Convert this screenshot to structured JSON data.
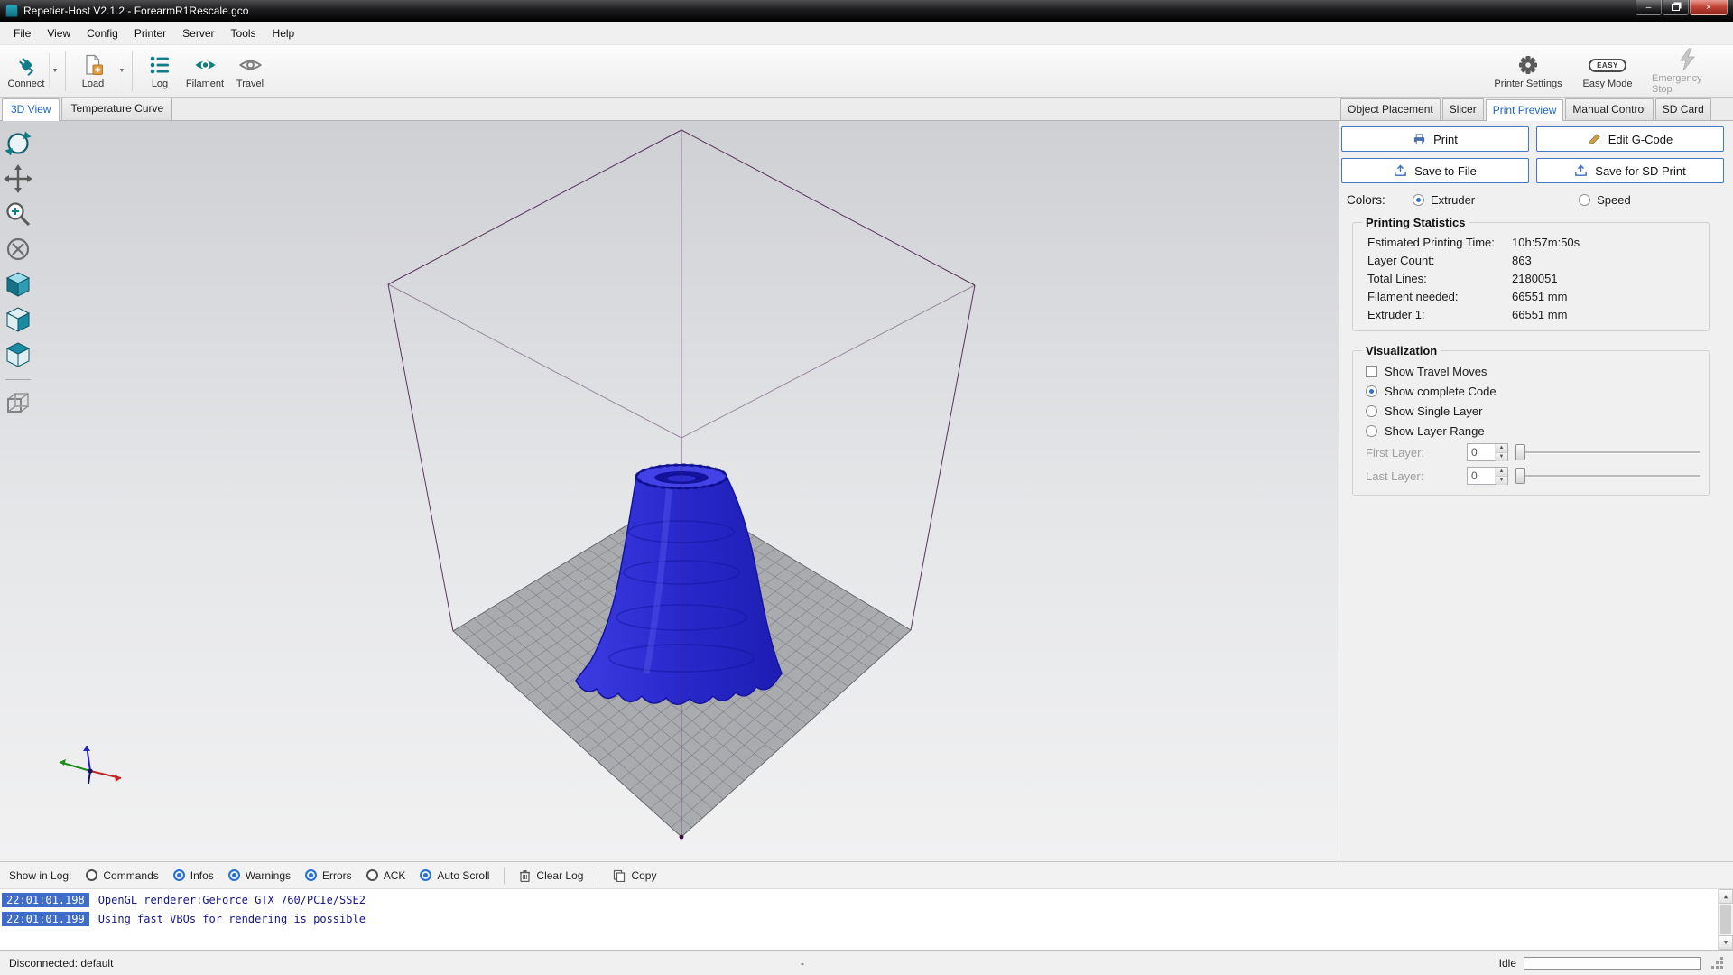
{
  "window": {
    "title": "Repetier-Host V2.1.2 - ForearmR1Rescale.gco"
  },
  "menu": {
    "items": [
      "File",
      "View",
      "Config",
      "Printer",
      "Server",
      "Tools",
      "Help"
    ]
  },
  "toolbar": {
    "connect": "Connect",
    "load": "Load",
    "log": "Log",
    "filament": "Filament",
    "travel": "Travel",
    "printer_settings": "Printer Settings",
    "easy_mode": "Easy Mode",
    "easy_badge": "EASY",
    "emergency_stop": "Emergency Stop"
  },
  "view_tabs": {
    "view3d": "3D View",
    "temperature": "Temperature Curve"
  },
  "right_tabs": {
    "object_placement": "Object Placement",
    "slicer": "Slicer",
    "print_preview": "Print Preview",
    "manual_control": "Manual Control",
    "sd_card": "SD Card"
  },
  "actions": {
    "print": "Print",
    "edit_gcode": "Edit G-Code",
    "save_file": "Save to File",
    "save_sd": "Save for SD Print"
  },
  "colors": {
    "label": "Colors:",
    "extruder": "Extruder",
    "speed": "Speed"
  },
  "stats": {
    "title": "Printing Statistics",
    "rows": [
      {
        "label": "Estimated Printing Time:",
        "value": "10h:57m:50s"
      },
      {
        "label": "Layer Count:",
        "value": "863"
      },
      {
        "label": "Total Lines:",
        "value": "2180051"
      },
      {
        "label": "Filament needed:",
        "value": "66551 mm"
      },
      {
        "label": "Extruder 1:",
        "value": "66551 mm"
      }
    ]
  },
  "visualization": {
    "title": "Visualization",
    "show_travel": "Show Travel Moves",
    "show_complete": "Show complete Code",
    "show_single": "Show Single Layer",
    "show_range": "Show Layer Range",
    "first_layer": "First Layer:",
    "last_layer": "Last Layer:",
    "first_value": "0",
    "last_value": "0"
  },
  "log_toolbar": {
    "label": "Show in Log:",
    "commands": "Commands",
    "infos": "Infos",
    "warnings": "Warnings",
    "errors": "Errors",
    "ack": "ACK",
    "auto_scroll": "Auto Scroll",
    "clear_log": "Clear Log",
    "copy": "Copy"
  },
  "log": {
    "lines": [
      {
        "time": "22:01:01.198",
        "text": "OpenGL renderer:GeForce GTX 760/PCIe/SSE2"
      },
      {
        "time": "22:01:01.199",
        "text": "Using fast VBOs for rendering is possible"
      }
    ]
  },
  "status": {
    "connection": "Disconnected: default",
    "center": "-",
    "state": "Idle"
  }
}
